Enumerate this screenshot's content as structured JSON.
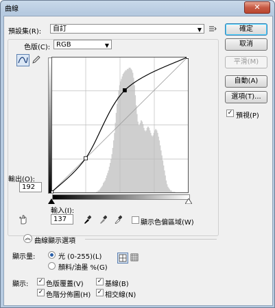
{
  "window": {
    "title": "曲線",
    "close_glyph": "✕"
  },
  "preset": {
    "label": "預設集(R):",
    "value": "自訂"
  },
  "channel": {
    "label": "色版(C):",
    "value": "RGB"
  },
  "buttons": {
    "ok": "確定",
    "cancel": "取消",
    "smooth": "平滑(M)",
    "auto": "自動(A)",
    "options": "選項(T)..."
  },
  "preview": {
    "label": "預視(P)",
    "checked": true
  },
  "output": {
    "label": "輸出(O):",
    "value": "192"
  },
  "input": {
    "label": "輸入(I):",
    "value": "137"
  },
  "show_clipping": {
    "label": "顯示色偏區域(W)",
    "checked": false
  },
  "display_options": {
    "title": "曲線顯示選項",
    "amount_label": "顯示量:",
    "light": "光 (0-255)(L)",
    "pigment": "顏料/油墨 %(G)",
    "show_label": "顯示:",
    "channel_overlays": "色版覆蓋(V)",
    "histogram": "色階分佈圖(H)",
    "baseline": "基線(B)",
    "intersection": "相交線(N)"
  },
  "chart_data": {
    "type": "line",
    "curve_points": [
      [
        0,
        0
      ],
      [
        64,
        64
      ],
      [
        137,
        192
      ],
      [
        255,
        255
      ]
    ],
    "histogram": [
      0,
      0,
      0,
      0,
      0,
      0,
      0,
      0,
      0,
      0,
      0,
      0,
      0,
      0,
      0,
      0,
      0,
      0,
      0,
      0,
      0,
      0,
      0,
      0,
      0,
      0,
      0,
      0,
      0,
      0,
      0,
      0,
      0,
      0,
      0,
      0,
      0,
      0,
      0,
      0,
      0,
      0,
      0,
      0,
      0,
      0,
      0,
      0,
      0,
      0,
      0,
      0,
      1,
      1,
      2,
      2,
      3,
      4,
      5,
      6,
      8,
      9,
      10,
      12,
      14,
      16,
      18,
      21,
      24,
      27,
      31,
      36,
      42,
      48,
      56,
      64,
      71,
      77,
      82,
      86,
      89,
      91,
      93,
      95,
      96,
      97,
      98,
      98,
      99,
      99,
      100,
      100,
      99,
      98,
      96,
      92,
      86,
      78,
      70,
      63,
      57,
      54,
      54,
      56,
      58,
      57,
      55,
      52,
      50,
      49,
      50,
      52,
      53,
      52,
      50,
      48,
      46,
      45,
      46,
      48,
      50,
      51,
      50,
      48,
      45,
      42,
      38,
      34,
      30,
      26,
      22,
      18,
      14,
      10,
      7,
      5,
      4,
      3,
      2,
      2,
      1,
      1,
      1,
      1,
      0,
      0,
      0,
      0,
      0,
      0,
      0,
      0,
      0,
      0,
      0,
      0,
      0,
      0,
      0,
      0
    ],
    "xlim": [
      0,
      255
    ],
    "ylim": [
      0,
      255
    ],
    "grid": true
  },
  "colors": {
    "accent": "#2a5fa8",
    "histogram": "#cfcfcf",
    "curve": "#000000"
  }
}
